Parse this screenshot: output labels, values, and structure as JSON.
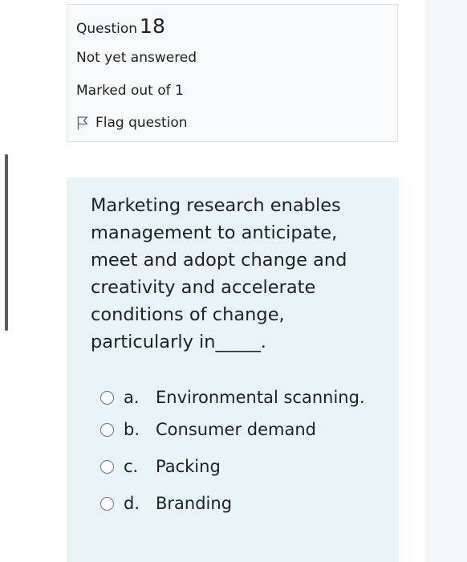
{
  "info": {
    "question_label": "Question",
    "question_number": "18",
    "state": "Not yet answered",
    "grade": "Marked out of 1",
    "flag_label": "Flag question",
    "flag_icon": "flag-outline-icon"
  },
  "question": {
    "text": "Marketing research enables management to anticipate, meet and adopt change and creativity and accelerate conditions of change, particularly in_____."
  },
  "answers": [
    {
      "letter": "a.",
      "text": "Environmental scanning.",
      "selected": false
    },
    {
      "letter": "b.",
      "text": "Consumer demand",
      "selected": false
    },
    {
      "letter": "c.",
      "text": "Packing",
      "selected": false
    },
    {
      "letter": "d.",
      "text": "Branding",
      "selected": false
    }
  ],
  "colors": {
    "info_background": "#f8f9fa",
    "info_border": "#dee2e6",
    "content_background": "#e7f3f5",
    "text": "#1d2125",
    "radio_border": "#6a737b"
  }
}
